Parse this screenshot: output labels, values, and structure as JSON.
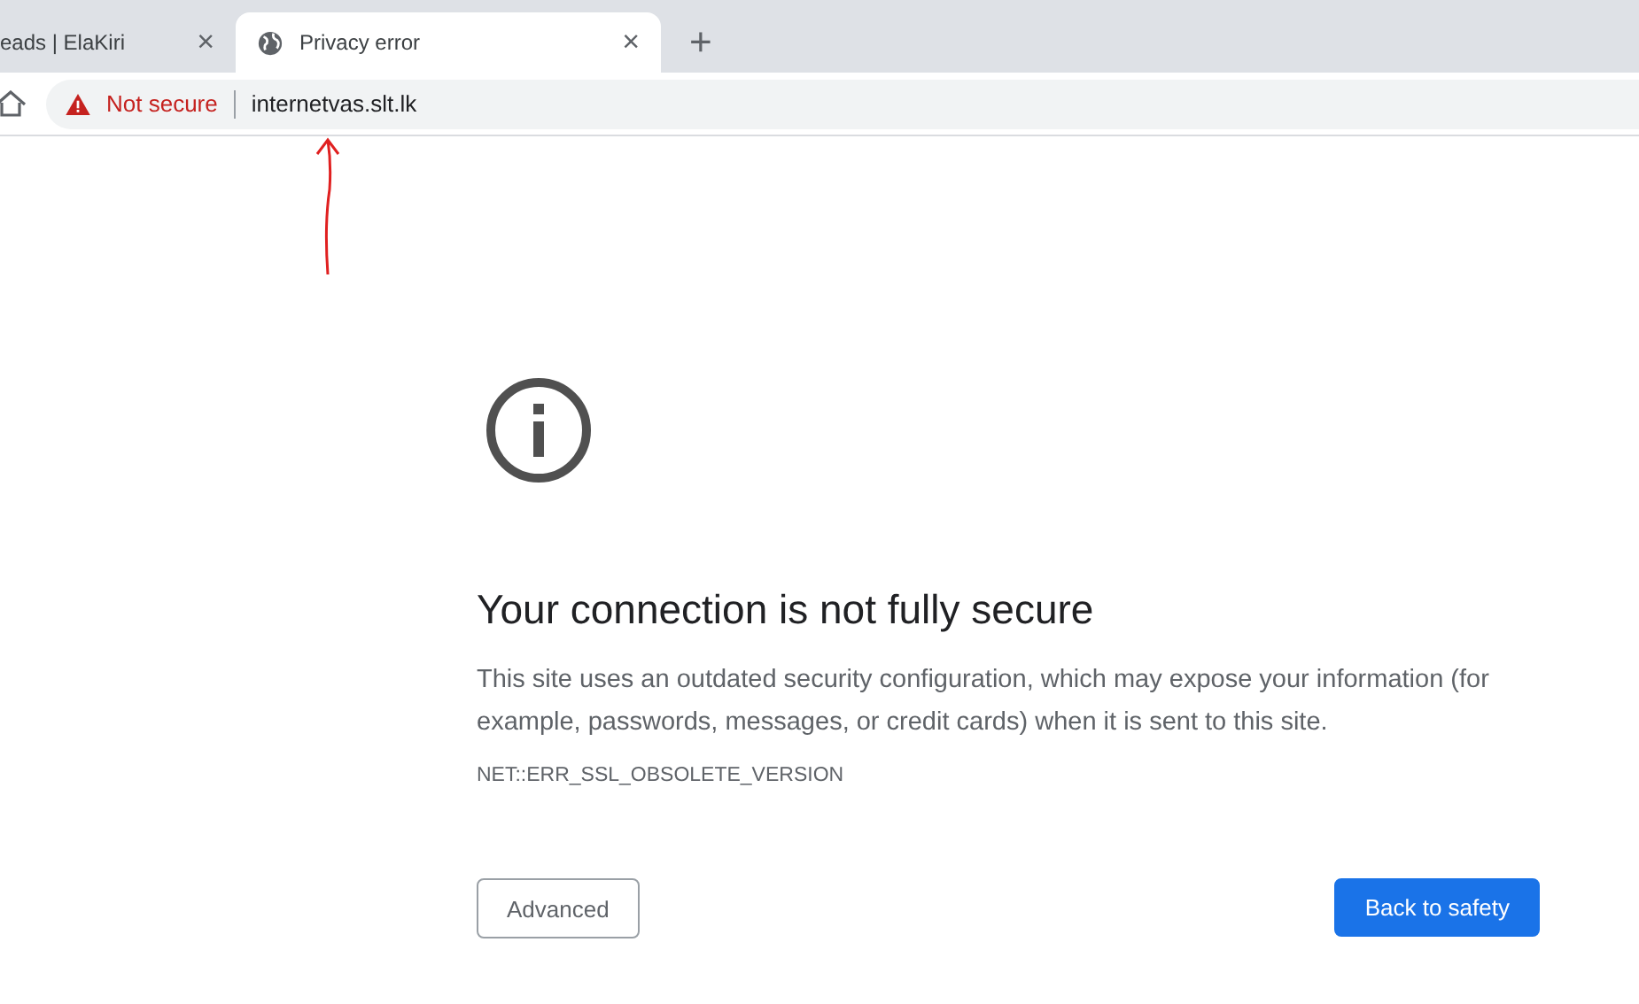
{
  "tabs": [
    {
      "title": "eads | ElaKiri",
      "selected": false,
      "close": "×"
    },
    {
      "title": "Privacy error",
      "selected": true,
      "close": "×"
    }
  ],
  "new_tab": "+",
  "address_bar": {
    "security": "Not secure",
    "url": "internetvas.slt.lk"
  },
  "page": {
    "heading": "Your connection is not fully secure",
    "body": "This site uses an outdated security configuration, which may expose your information (for example, passwords, messages, or credit cards) when it is sent to this site.",
    "error_code": "NET::ERR_SSL_OBSOLETE_VERSION",
    "buttons": [
      {
        "label": "Advanced",
        "kind": "secondary"
      },
      {
        "label": "Back to safety",
        "kind": "primary"
      }
    ]
  }
}
